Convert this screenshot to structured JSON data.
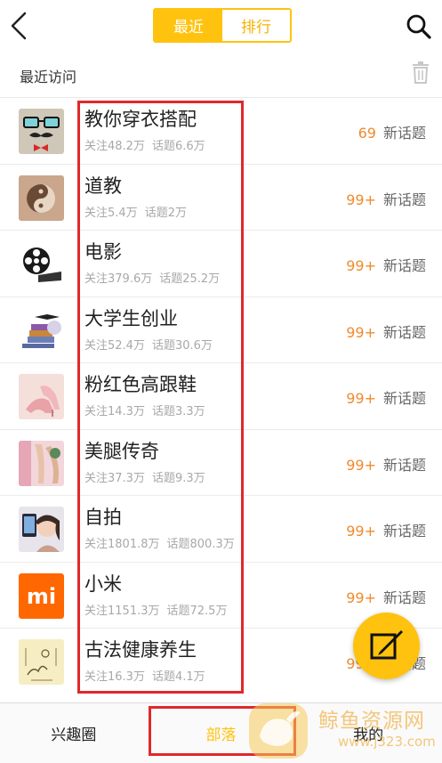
{
  "header": {
    "tabs": [
      {
        "label": "最近",
        "active": true
      },
      {
        "label": "排行",
        "active": false
      }
    ]
  },
  "section": {
    "title": "最近访问"
  },
  "items": [
    {
      "name": "教你穿衣搭配",
      "follow": "关注48.2万",
      "topics": "话题6.6万",
      "count": "69",
      "new_label": "新话题",
      "avatar": "glasses-mustache-bowtie"
    },
    {
      "name": "道教",
      "follow": "关注5.4万",
      "topics": "话题2万",
      "count": "99+",
      "new_label": "新话题",
      "avatar": "yin-yang"
    },
    {
      "name": "电影",
      "follow": "关注379.6万",
      "topics": "话题25.2万",
      "count": "99+",
      "new_label": "新话题",
      "avatar": "film-reel"
    },
    {
      "name": "大学生创业",
      "follow": "关注52.4万",
      "topics": "话题30.6万",
      "count": "99+",
      "new_label": "新话题",
      "avatar": "graduate-books"
    },
    {
      "name": "粉红色高跟鞋",
      "follow": "关注14.3万",
      "topics": "话题3.3万",
      "count": "99+",
      "new_label": "新话题",
      "avatar": "pink-heels"
    },
    {
      "name": "美腿传奇",
      "follow": "关注37.3万",
      "topics": "话题9.3万",
      "count": "99+",
      "new_label": "新话题",
      "avatar": "legs-photo"
    },
    {
      "name": "自拍",
      "follow": "关注1801.8万",
      "topics": "话题800.3万",
      "count": "99+",
      "new_label": "新话题",
      "avatar": "selfie-photo"
    },
    {
      "name": "小米",
      "follow": "关注1151.3万",
      "topics": "话题72.5万",
      "count": "99+",
      "new_label": "新话题",
      "avatar": "mi-logo"
    },
    {
      "name": "古法健康养生",
      "follow": "关注16.3万",
      "topics": "话题4.1万",
      "count": "99+",
      "new_label": "新话题",
      "avatar": "ancient-scroll"
    }
  ],
  "mi_logo_text": "mi",
  "bottom_tabs": [
    {
      "label": "兴趣圈",
      "active": false
    },
    {
      "label": "部落",
      "active": true
    },
    {
      "label": "我的",
      "active": false
    }
  ],
  "watermark": {
    "line1": "鲸鱼资源网",
    "line2": "www.j323.com"
  },
  "colors": {
    "accent": "#ffc20e",
    "count": "#f08a2e",
    "highlight": "#e0282a"
  }
}
